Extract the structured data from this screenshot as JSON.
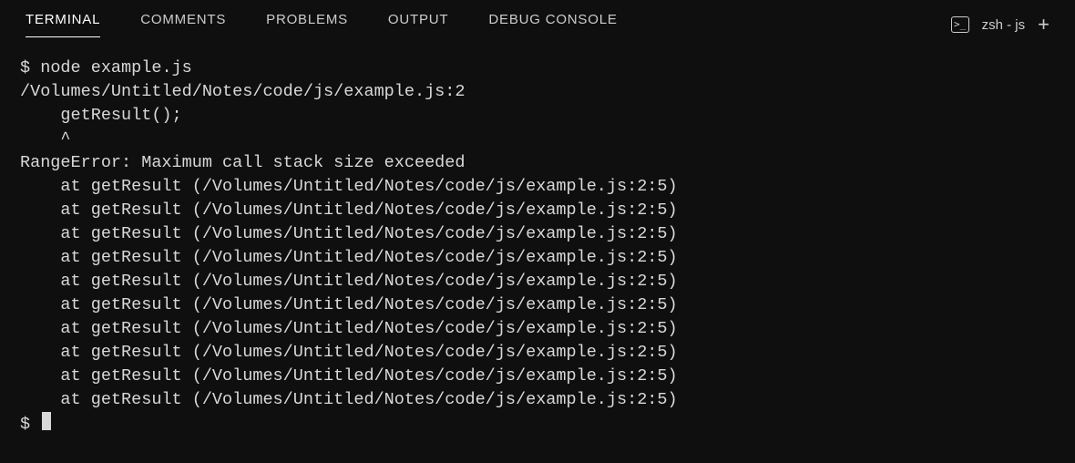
{
  "tabs": {
    "items": [
      {
        "label": "TERMINAL",
        "active": true
      },
      {
        "label": "COMMENTS",
        "active": false
      },
      {
        "label": "PROBLEMS",
        "active": false
      },
      {
        "label": "OUTPUT",
        "active": false
      },
      {
        "label": "DEBUG CONSOLE",
        "active": false
      }
    ]
  },
  "shell": {
    "name": "zsh - js",
    "icon_glyph": ">_"
  },
  "terminal": {
    "prompt": "$",
    "command": "node example.js",
    "file_line": "/Volumes/Untitled/Notes/code/js/example.js:2",
    "call_line": "    getResult();",
    "caret_line": "    ^",
    "blank": "",
    "error_title": "RangeError: Maximum call stack size exceeded",
    "stack": [
      "    at getResult (/Volumes/Untitled/Notes/code/js/example.js:2:5)",
      "    at getResult (/Volumes/Untitled/Notes/code/js/example.js:2:5)",
      "    at getResult (/Volumes/Untitled/Notes/code/js/example.js:2:5)",
      "    at getResult (/Volumes/Untitled/Notes/code/js/example.js:2:5)",
      "    at getResult (/Volumes/Untitled/Notes/code/js/example.js:2:5)",
      "    at getResult (/Volumes/Untitled/Notes/code/js/example.js:2:5)",
      "    at getResult (/Volumes/Untitled/Notes/code/js/example.js:2:5)",
      "    at getResult (/Volumes/Untitled/Notes/code/js/example.js:2:5)",
      "    at getResult (/Volumes/Untitled/Notes/code/js/example.js:2:5)",
      "    at getResult (/Volumes/Untitled/Notes/code/js/example.js:2:5)"
    ]
  }
}
